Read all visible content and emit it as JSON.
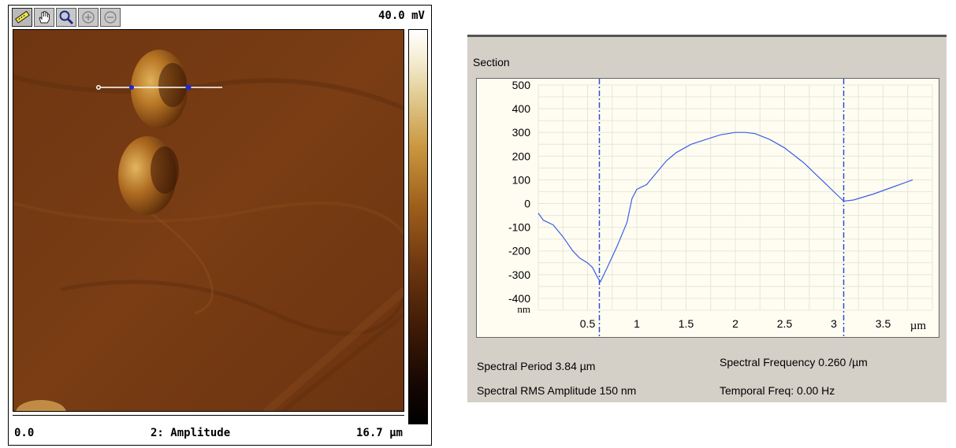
{
  "afm_viewer": {
    "toolbar": [
      {
        "name": "ruler-tool-button",
        "icon": "ruler-icon",
        "active": true
      },
      {
        "name": "pan-tool-button",
        "icon": "hand-icon",
        "active": false
      },
      {
        "name": "zoom-tool-button",
        "icon": "magnifier-icon",
        "active": false
      },
      {
        "name": "zoom-in-button",
        "icon": "zoom-in-icon",
        "active": false
      },
      {
        "name": "zoom-out-button",
        "icon": "zoom-out-icon",
        "active": false
      }
    ],
    "scale_max": "40.0 mV",
    "axis_min": "0.0",
    "channel": "2: Amplitude",
    "axis_max": "16.7 µm"
  },
  "section": {
    "title": "Section",
    "chart_data": {
      "type": "line",
      "xlabel": "µm",
      "ylabel": "nm",
      "xlim": [
        0,
        4.0
      ],
      "ylim": [
        -450,
        500
      ],
      "x_ticks": [
        "0.5",
        "1",
        "1.5",
        "2",
        "2.5",
        "3",
        "3.5"
      ],
      "y_ticks": [
        "500",
        "400",
        "300",
        "200",
        "100",
        "0",
        "-100",
        "-200",
        "-300",
        "-400"
      ],
      "grid": true,
      "cursors": [
        0.62,
        3.1
      ],
      "series": [
        {
          "color": "#3c5ee6",
          "x": [
            0.0,
            0.05,
            0.15,
            0.25,
            0.35,
            0.42,
            0.5,
            0.55,
            0.6,
            0.63,
            0.7,
            0.8,
            0.9,
            0.95,
            1.0,
            1.1,
            1.2,
            1.3,
            1.4,
            1.55,
            1.7,
            1.85,
            2.0,
            2.1,
            2.2,
            2.35,
            2.5,
            2.7,
            2.9,
            3.05,
            3.1,
            3.2,
            3.4,
            3.6,
            3.8
          ],
          "y": [
            -40,
            -70,
            -90,
            -140,
            -200,
            -230,
            -250,
            -270,
            -310,
            -330,
            -270,
            -180,
            -80,
            20,
            60,
            80,
            130,
            180,
            215,
            250,
            270,
            290,
            300,
            300,
            295,
            270,
            235,
            170,
            90,
            30,
            10,
            15,
            40,
            70,
            100
          ]
        }
      ]
    },
    "stats": {
      "period": "Spectral Period 3.84 µm",
      "rms": "Spectral RMS Amplitude 150 nm",
      "freq": "Spectral Frequency 0.260 /µm",
      "temporal": "Temporal Freq: 0.00 Hz"
    }
  }
}
